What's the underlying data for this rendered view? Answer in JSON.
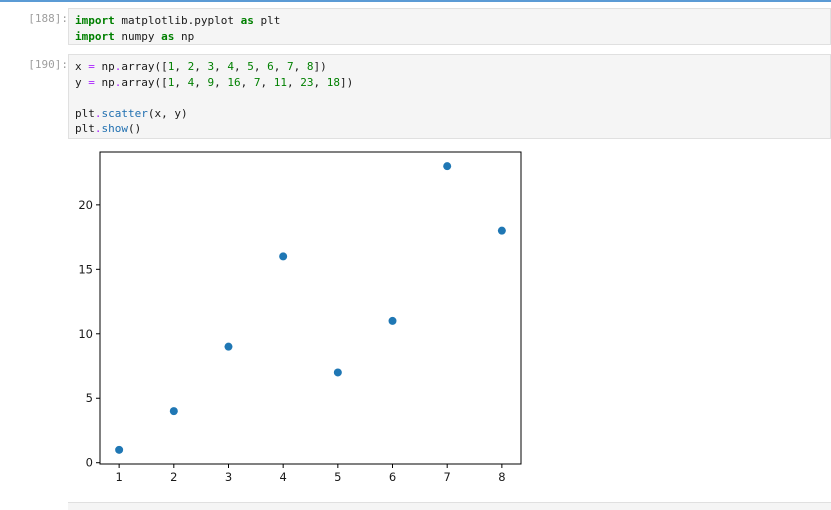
{
  "cell1": {
    "prompt": "[188]:",
    "lines": [
      [
        {
          "t": "import",
          "c": "kw"
        },
        {
          "t": " matplotlib.pyplot ",
          "c": ""
        },
        {
          "t": "as",
          "c": "kw"
        },
        {
          "t": " plt",
          "c": ""
        }
      ],
      [
        {
          "t": "import",
          "c": "kw"
        },
        {
          "t": " numpy ",
          "c": ""
        },
        {
          "t": "as",
          "c": "kw"
        },
        {
          "t": " np",
          "c": ""
        }
      ]
    ]
  },
  "cell2": {
    "prompt": "[190]:",
    "lines": [
      [
        {
          "t": "x ",
          "c": ""
        },
        {
          "t": "=",
          "c": "op"
        },
        {
          "t": " np",
          "c": ""
        },
        {
          "t": ".",
          "c": "op"
        },
        {
          "t": "array([",
          "c": ""
        },
        {
          "t": "1",
          "c": "num"
        },
        {
          "t": ", ",
          "c": ""
        },
        {
          "t": "2",
          "c": "num"
        },
        {
          "t": ", ",
          "c": ""
        },
        {
          "t": "3",
          "c": "num"
        },
        {
          "t": ", ",
          "c": ""
        },
        {
          "t": "4",
          "c": "num"
        },
        {
          "t": ", ",
          "c": ""
        },
        {
          "t": "5",
          "c": "num"
        },
        {
          "t": ", ",
          "c": ""
        },
        {
          "t": "6",
          "c": "num"
        },
        {
          "t": ", ",
          "c": ""
        },
        {
          "t": "7",
          "c": "num"
        },
        {
          "t": ", ",
          "c": ""
        },
        {
          "t": "8",
          "c": "num"
        },
        {
          "t": "])",
          "c": ""
        }
      ],
      [
        {
          "t": "y ",
          "c": ""
        },
        {
          "t": "=",
          "c": "op"
        },
        {
          "t": " np",
          "c": ""
        },
        {
          "t": ".",
          "c": "op"
        },
        {
          "t": "array([",
          "c": ""
        },
        {
          "t": "1",
          "c": "num"
        },
        {
          "t": ", ",
          "c": ""
        },
        {
          "t": "4",
          "c": "num"
        },
        {
          "t": ", ",
          "c": ""
        },
        {
          "t": "9",
          "c": "num"
        },
        {
          "t": ", ",
          "c": ""
        },
        {
          "t": "16",
          "c": "num"
        },
        {
          "t": ", ",
          "c": ""
        },
        {
          "t": "7",
          "c": "num"
        },
        {
          "t": ", ",
          "c": ""
        },
        {
          "t": "11",
          "c": "num"
        },
        {
          "t": ", ",
          "c": ""
        },
        {
          "t": "23",
          "c": "num"
        },
        {
          "t": ", ",
          "c": ""
        },
        {
          "t": "18",
          "c": "num"
        },
        {
          "t": "])",
          "c": ""
        }
      ],
      [],
      [
        {
          "t": "plt",
          "c": ""
        },
        {
          "t": ".",
          "c": "op"
        },
        {
          "t": "scatter",
          "c": "call"
        },
        {
          "t": "(x, y)",
          "c": ""
        }
      ],
      [
        {
          "t": "plt",
          "c": ""
        },
        {
          "t": ".",
          "c": "op"
        },
        {
          "t": "show",
          "c": "call"
        },
        {
          "t": "()",
          "c": ""
        }
      ]
    ]
  },
  "chart_data": {
    "type": "scatter",
    "x": [
      1,
      2,
      3,
      4,
      5,
      6,
      7,
      8
    ],
    "y": [
      1,
      4,
      9,
      16,
      7,
      11,
      23,
      18
    ],
    "xticks": [
      1,
      2,
      3,
      4,
      5,
      6,
      7,
      8
    ],
    "yticks": [
      0,
      5,
      10,
      15,
      20
    ],
    "xlim": [
      0.65,
      8.35
    ],
    "ylim": [
      -0.1,
      24.1
    ],
    "marker_color": "#1f77b4",
    "grid": false,
    "title": "",
    "xlabel": "",
    "ylabel": ""
  },
  "colors": {
    "prompt": "#9e9e9e",
    "keyword": "#008000",
    "operator": "#aa22ff",
    "accent": "#5b9bd5"
  }
}
